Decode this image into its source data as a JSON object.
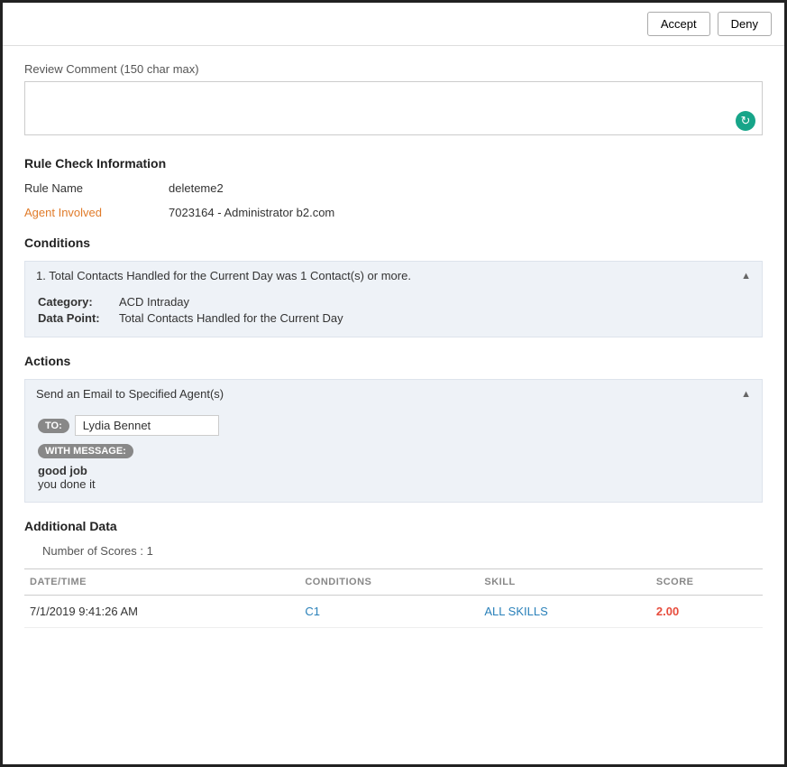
{
  "topbar": {
    "accept_label": "Accept",
    "deny_label": "Deny"
  },
  "review_comment": {
    "label": "Review Comment (150 char max)",
    "placeholder": "",
    "value": "",
    "refresh_icon": "↻"
  },
  "rule_check": {
    "section_title": "Rule Check Information",
    "rule_name_label": "Rule Name",
    "rule_name_value": "deleteme2",
    "agent_label": "Agent Involved",
    "agent_value": "7023164 - Administrator b2.com"
  },
  "conditions": {
    "section_title": "Conditions",
    "items": [
      {
        "header": "1. Total Contacts Handled for the Current Day was 1 Contact(s) or more.",
        "category_label": "Category:",
        "category_value": "ACD Intraday",
        "datapoint_label": "Data Point:",
        "datapoint_value": "Total Contacts Handled for the Current Day"
      }
    ]
  },
  "actions": {
    "section_title": "Actions",
    "items": [
      {
        "header": "Send an Email to Specified Agent(s)",
        "to_tag": "TO:",
        "to_value": "Lydia Bennet",
        "message_tag": "WITH MESSAGE:",
        "message_line1": "good job",
        "message_line2": "you done it"
      }
    ]
  },
  "additional_data": {
    "section_title": "Additional Data",
    "score_count_label": "Number of Scores : 1",
    "table": {
      "headers": [
        "DATE/TIME",
        "CONDITIONS",
        "SKILL",
        "SCORE"
      ],
      "rows": [
        {
          "datetime": "7/1/2019 9:41:26 AM",
          "conditions": "C1",
          "skill": "ALL SKILLS",
          "score": "2.00"
        }
      ]
    }
  }
}
